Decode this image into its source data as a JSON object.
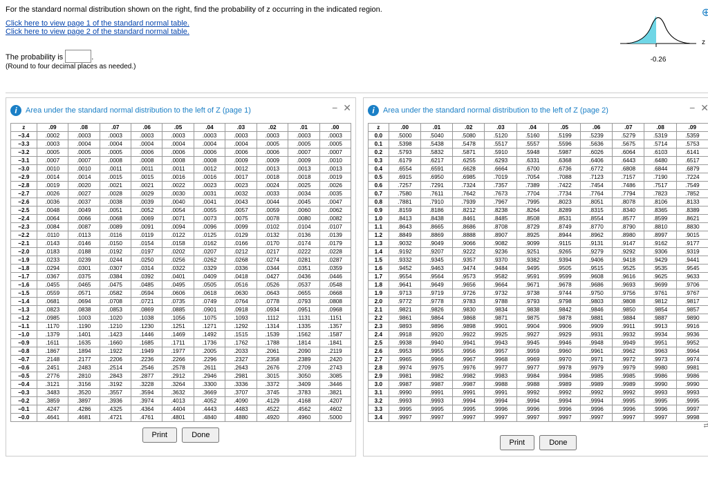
{
  "prompt": "For the standard normal distribution shown on the right, find the probability of z occurring in the indicated region.",
  "links": {
    "p1": "Click here to view page 1 of the standard normal table.",
    "p2": "Click here to view page 2 of the standard normal table."
  },
  "curve_label": "-0.26",
  "curve_axis": "z",
  "answer": {
    "label": "The probability is",
    "hint": "(Round to four decimal places as needed.)"
  },
  "panel1": {
    "title": "Area under the standard normal distribution to the left of Z (page 1)",
    "head": [
      "z",
      ".09",
      ".08",
      ".07",
      ".06",
      ".05",
      ".04",
      ".03",
      ".02",
      ".01",
      ".00"
    ],
    "rows": [
      [
        "−3.4",
        ".0002",
        ".0003",
        ".0003",
        ".0003",
        ".0003",
        ".0003",
        ".0003",
        ".0003",
        ".0003",
        ".0003"
      ],
      [
        "−3.3",
        ".0003",
        ".0004",
        ".0004",
        ".0004",
        ".0004",
        ".0004",
        ".0004",
        ".0005",
        ".0005",
        ".0005"
      ],
      [
        "−3.2",
        ".0005",
        ".0005",
        ".0005",
        ".0006",
        ".0006",
        ".0006",
        ".0006",
        ".0006",
        ".0007",
        ".0007"
      ],
      [
        "−3.1",
        ".0007",
        ".0007",
        ".0008",
        ".0008",
        ".0008",
        ".0008",
        ".0009",
        ".0009",
        ".0009",
        ".0010"
      ],
      [
        "−3.0",
        ".0010",
        ".0010",
        ".0011",
        ".0011",
        ".0011",
        ".0012",
        ".0012",
        ".0013",
        ".0013",
        ".0013"
      ],
      [
        "−2.9",
        ".0014",
        ".0014",
        ".0015",
        ".0015",
        ".0016",
        ".0016",
        ".0017",
        ".0018",
        ".0018",
        ".0019"
      ],
      [
        "−2.8",
        ".0019",
        ".0020",
        ".0021",
        ".0021",
        ".0022",
        ".0023",
        ".0023",
        ".0024",
        ".0025",
        ".0026"
      ],
      [
        "−2.7",
        ".0026",
        ".0027",
        ".0028",
        ".0029",
        ".0030",
        ".0031",
        ".0032",
        ".0033",
        ".0034",
        ".0035"
      ],
      [
        "−2.6",
        ".0036",
        ".0037",
        ".0038",
        ".0039",
        ".0040",
        ".0041",
        ".0043",
        ".0044",
        ".0045",
        ".0047"
      ],
      [
        "−2.5",
        ".0048",
        ".0049",
        ".0051",
        ".0052",
        ".0054",
        ".0055",
        ".0057",
        ".0059",
        ".0060",
        ".0062"
      ],
      [
        "−2.4",
        ".0064",
        ".0066",
        ".0068",
        ".0069",
        ".0071",
        ".0073",
        ".0075",
        ".0078",
        ".0080",
        ".0082"
      ],
      [
        "−2.3",
        ".0084",
        ".0087",
        ".0089",
        ".0091",
        ".0094",
        ".0096",
        ".0099",
        ".0102",
        ".0104",
        ".0107"
      ],
      [
        "−2.2",
        ".0110",
        ".0113",
        ".0116",
        ".0119",
        ".0122",
        ".0125",
        ".0129",
        ".0132",
        ".0136",
        ".0139"
      ],
      [
        "−2.1",
        ".0143",
        ".0146",
        ".0150",
        ".0154",
        ".0158",
        ".0162",
        ".0166",
        ".0170",
        ".0174",
        ".0179"
      ],
      [
        "−2.0",
        ".0183",
        ".0188",
        ".0192",
        ".0197",
        ".0202",
        ".0207",
        ".0212",
        ".0217",
        ".0222",
        ".0228"
      ],
      [
        "−1.9",
        ".0233",
        ".0239",
        ".0244",
        ".0250",
        ".0256",
        ".0262",
        ".0268",
        ".0274",
        ".0281",
        ".0287"
      ],
      [
        "−1.8",
        ".0294",
        ".0301",
        ".0307",
        ".0314",
        ".0322",
        ".0329",
        ".0336",
        ".0344",
        ".0351",
        ".0359"
      ],
      [
        "−1.7",
        ".0367",
        ".0375",
        ".0384",
        ".0392",
        ".0401",
        ".0409",
        ".0418",
        ".0427",
        ".0436",
        ".0446"
      ],
      [
        "−1.6",
        ".0455",
        ".0465",
        ".0475",
        ".0485",
        ".0495",
        ".0505",
        ".0516",
        ".0526",
        ".0537",
        ".0548"
      ],
      [
        "−1.5",
        ".0559",
        ".0571",
        ".0582",
        ".0594",
        ".0606",
        ".0618",
        ".0630",
        ".0643",
        ".0655",
        ".0668"
      ],
      [
        "−1.4",
        ".0681",
        ".0694",
        ".0708",
        ".0721",
        ".0735",
        ".0749",
        ".0764",
        ".0778",
        ".0793",
        ".0808"
      ],
      [
        "−1.3",
        ".0823",
        ".0838",
        ".0853",
        ".0869",
        ".0885",
        ".0901",
        ".0918",
        ".0934",
        ".0951",
        ".0968"
      ],
      [
        "−1.2",
        ".0985",
        ".1003",
        ".1020",
        ".1038",
        ".1056",
        ".1075",
        ".1093",
        ".1112",
        ".1131",
        ".1151"
      ],
      [
        "−1.1",
        ".1170",
        ".1190",
        ".1210",
        ".1230",
        ".1251",
        ".1271",
        ".1292",
        ".1314",
        ".1335",
        ".1357"
      ],
      [
        "−1.0",
        ".1379",
        ".1401",
        ".1423",
        ".1446",
        ".1469",
        ".1492",
        ".1515",
        ".1539",
        ".1562",
        ".1587"
      ],
      [
        "−0.9",
        ".1611",
        ".1635",
        ".1660",
        ".1685",
        ".1711",
        ".1736",
        ".1762",
        ".1788",
        ".1814",
        ".1841"
      ],
      [
        "−0.8",
        ".1867",
        ".1894",
        ".1922",
        ".1949",
        ".1977",
        ".2005",
        ".2033",
        ".2061",
        ".2090",
        ".2119"
      ],
      [
        "−0.7",
        ".2148",
        ".2177",
        ".2206",
        ".2236",
        ".2266",
        ".2296",
        ".2327",
        ".2358",
        ".2389",
        ".2420"
      ],
      [
        "−0.6",
        ".2451",
        ".2483",
        ".2514",
        ".2546",
        ".2578",
        ".2611",
        ".2643",
        ".2676",
        ".2709",
        ".2743"
      ],
      [
        "−0.5",
        ".2776",
        ".2810",
        ".2843",
        ".2877",
        ".2912",
        ".2946",
        ".2981",
        ".3015",
        ".3050",
        ".3085"
      ],
      [
        "−0.4",
        ".3121",
        ".3156",
        ".3192",
        ".3228",
        ".3264",
        ".3300",
        ".3336",
        ".3372",
        ".3409",
        ".3446"
      ],
      [
        "−0.3",
        ".3483",
        ".3520",
        ".3557",
        ".3594",
        ".3632",
        ".3669",
        ".3707",
        ".3745",
        ".3783",
        ".3821"
      ],
      [
        "−0.2",
        ".3859",
        ".3897",
        ".3936",
        ".3974",
        ".4013",
        ".4052",
        ".4090",
        ".4129",
        ".4168",
        ".4207"
      ],
      [
        "−0.1",
        ".4247",
        ".4286",
        ".4325",
        ".4364",
        ".4404",
        ".4443",
        ".4483",
        ".4522",
        ".4562",
        ".4602"
      ],
      [
        "−0.0",
        ".4641",
        ".4681",
        ".4721",
        ".4761",
        ".4801",
        ".4840",
        ".4880",
        ".4920",
        ".4960",
        ".5000"
      ]
    ]
  },
  "panel2": {
    "title": "Area under the standard normal distribution to the left of Z (page 2)",
    "head": [
      "z",
      ".00",
      ".01",
      ".02",
      ".03",
      ".04",
      ".05",
      ".06",
      ".07",
      ".08",
      ".09"
    ],
    "rows": [
      [
        "0.0",
        ".5000",
        ".5040",
        ".5080",
        ".5120",
        ".5160",
        ".5199",
        ".5239",
        ".5279",
        ".5319",
        ".5359"
      ],
      [
        "0.1",
        ".5398",
        ".5438",
        ".5478",
        ".5517",
        ".5557",
        ".5596",
        ".5636",
        ".5675",
        ".5714",
        ".5753"
      ],
      [
        "0.2",
        ".5793",
        ".5832",
        ".5871",
        ".5910",
        ".5948",
        ".5987",
        ".6026",
        ".6064",
        ".6103",
        ".6141"
      ],
      [
        "0.3",
        ".6179",
        ".6217",
        ".6255",
        ".6293",
        ".6331",
        ".6368",
        ".6406",
        ".6443",
        ".6480",
        ".6517"
      ],
      [
        "0.4",
        ".6554",
        ".6591",
        ".6628",
        ".6664",
        ".6700",
        ".6736",
        ".6772",
        ".6808",
        ".6844",
        ".6879"
      ],
      [
        "0.5",
        ".6915",
        ".6950",
        ".6985",
        ".7019",
        ".7054",
        ".7088",
        ".7123",
        ".7157",
        ".7190",
        ".7224"
      ],
      [
        "0.6",
        ".7257",
        ".7291",
        ".7324",
        ".7357",
        ".7389",
        ".7422",
        ".7454",
        ".7486",
        ".7517",
        ".7549"
      ],
      [
        "0.7",
        ".7580",
        ".7611",
        ".7642",
        ".7673",
        ".7704",
        ".7734",
        ".7764",
        ".7794",
        ".7823",
        ".7852"
      ],
      [
        "0.8",
        ".7881",
        ".7910",
        ".7939",
        ".7967",
        ".7995",
        ".8023",
        ".8051",
        ".8078",
        ".8106",
        ".8133"
      ],
      [
        "0.9",
        ".8159",
        ".8186",
        ".8212",
        ".8238",
        ".8264",
        ".8289",
        ".8315",
        ".8340",
        ".8365",
        ".8389"
      ],
      [
        "1.0",
        ".8413",
        ".8438",
        ".8461",
        ".8485",
        ".8508",
        ".8531",
        ".8554",
        ".8577",
        ".8599",
        ".8621"
      ],
      [
        "1.1",
        ".8643",
        ".8665",
        ".8686",
        ".8708",
        ".8729",
        ".8749",
        ".8770",
        ".8790",
        ".8810",
        ".8830"
      ],
      [
        "1.2",
        ".8849",
        ".8869",
        ".8888",
        ".8907",
        ".8925",
        ".8944",
        ".8962",
        ".8980",
        ".8997",
        ".9015"
      ],
      [
        "1.3",
        ".9032",
        ".9049",
        ".9066",
        ".9082",
        ".9099",
        ".9115",
        ".9131",
        ".9147",
        ".9162",
        ".9177"
      ],
      [
        "1.4",
        ".9192",
        ".9207",
        ".9222",
        ".9236",
        ".9251",
        ".9265",
        ".9279",
        ".9292",
        ".9306",
        ".9319"
      ],
      [
        "1.5",
        ".9332",
        ".9345",
        ".9357",
        ".9370",
        ".9382",
        ".9394",
        ".9406",
        ".9418",
        ".9429",
        ".9441"
      ],
      [
        "1.6",
        ".9452",
        ".9463",
        ".9474",
        ".9484",
        ".9495",
        ".9505",
        ".9515",
        ".9525",
        ".9535",
        ".9545"
      ],
      [
        "1.7",
        ".9554",
        ".9564",
        ".9573",
        ".9582",
        ".9591",
        ".9599",
        ".9608",
        ".9616",
        ".9625",
        ".9633"
      ],
      [
        "1.8",
        ".9641",
        ".9649",
        ".9656",
        ".9664",
        ".9671",
        ".9678",
        ".9686",
        ".9693",
        ".9699",
        ".9706"
      ],
      [
        "1.9",
        ".9713",
        ".9719",
        ".9726",
        ".9732",
        ".9738",
        ".9744",
        ".9750",
        ".9756",
        ".9761",
        ".9767"
      ],
      [
        "2.0",
        ".9772",
        ".9778",
        ".9783",
        ".9788",
        ".9793",
        ".9798",
        ".9803",
        ".9808",
        ".9812",
        ".9817"
      ],
      [
        "2.1",
        ".9821",
        ".9826",
        ".9830",
        ".9834",
        ".9838",
        ".9842",
        ".9846",
        ".9850",
        ".9854",
        ".9857"
      ],
      [
        "2.2",
        ".9861",
        ".9864",
        ".9868",
        ".9871",
        ".9875",
        ".9878",
        ".9881",
        ".9884",
        ".9887",
        ".9890"
      ],
      [
        "2.3",
        ".9893",
        ".9896",
        ".9898",
        ".9901",
        ".9904",
        ".9906",
        ".9909",
        ".9911",
        ".9913",
        ".9916"
      ],
      [
        "2.4",
        ".9918",
        ".9920",
        ".9922",
        ".9925",
        ".9927",
        ".9929",
        ".9931",
        ".9932",
        ".9934",
        ".9936"
      ],
      [
        "2.5",
        ".9938",
        ".9940",
        ".9941",
        ".9943",
        ".9945",
        ".9946",
        ".9948",
        ".9949",
        ".9951",
        ".9952"
      ],
      [
        "2.6",
        ".9953",
        ".9955",
        ".9956",
        ".9957",
        ".9959",
        ".9960",
        ".9961",
        ".9962",
        ".9963",
        ".9964"
      ],
      [
        "2.7",
        ".9965",
        ".9966",
        ".9967",
        ".9968",
        ".9969",
        ".9970",
        ".9971",
        ".9972",
        ".9973",
        ".9974"
      ],
      [
        "2.8",
        ".9974",
        ".9975",
        ".9976",
        ".9977",
        ".9977",
        ".9978",
        ".9979",
        ".9979",
        ".9980",
        ".9981"
      ],
      [
        "2.9",
        ".9981",
        ".9982",
        ".9982",
        ".9983",
        ".9984",
        ".9984",
        ".9985",
        ".9985",
        ".9986",
        ".9986"
      ],
      [
        "3.0",
        ".9987",
        ".9987",
        ".9987",
        ".9988",
        ".9988",
        ".9989",
        ".9989",
        ".9989",
        ".9990",
        ".9990"
      ],
      [
        "3.1",
        ".9990",
        ".9991",
        ".9991",
        ".9991",
        ".9992",
        ".9992",
        ".9992",
        ".9992",
        ".9993",
        ".9993"
      ],
      [
        "3.2",
        ".9993",
        ".9993",
        ".9994",
        ".9994",
        ".9994",
        ".9994",
        ".9994",
        ".9995",
        ".9995",
        ".9995"
      ],
      [
        "3.3",
        ".9995",
        ".9995",
        ".9995",
        ".9996",
        ".9996",
        ".9996",
        ".9996",
        ".9996",
        ".9996",
        ".9997"
      ],
      [
        "3.4",
        ".9997",
        ".9997",
        ".9997",
        ".9997",
        ".9997",
        ".9997",
        ".9997",
        ".9997",
        ".9997",
        ".9998"
      ]
    ]
  },
  "buttons": {
    "print": "Print",
    "done": "Done"
  }
}
